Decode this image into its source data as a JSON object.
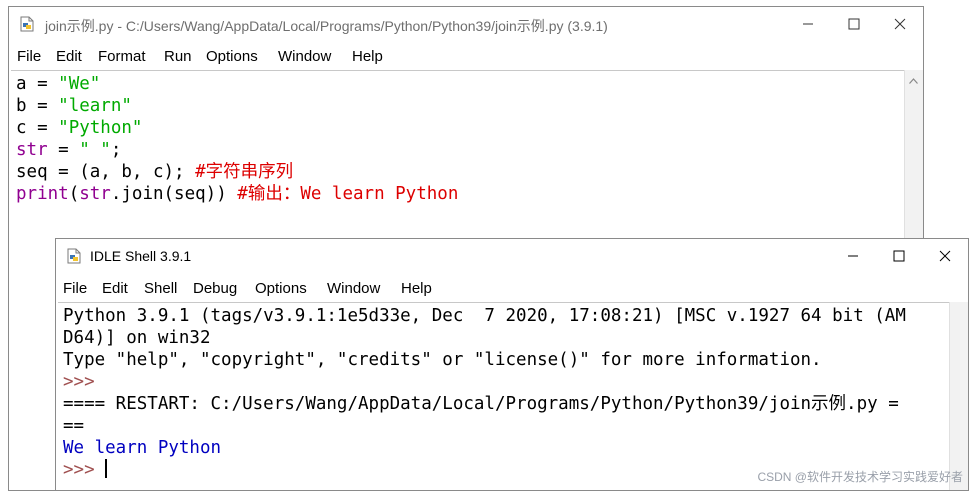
{
  "editor": {
    "title": "join示例.py - C:/Users/Wang/AppData/Local/Programs/Python/Python39/join示例.py (3.9.1)",
    "menu": [
      "File",
      "Edit",
      "Format",
      "Run",
      "Options",
      "Window",
      "Help"
    ],
    "code": [
      [
        {
          "t": "a = ",
          "c": ""
        },
        {
          "t": "\"We\"",
          "c": "str"
        }
      ],
      [
        {
          "t": "b = ",
          "c": ""
        },
        {
          "t": "\"learn\"",
          "c": "str"
        }
      ],
      [
        {
          "t": "c = ",
          "c": ""
        },
        {
          "t": "\"Python\"",
          "c": "str"
        }
      ],
      [
        {
          "t": "str",
          "c": "bi"
        },
        {
          "t": " = ",
          "c": ""
        },
        {
          "t": "\" \"",
          "c": "str"
        },
        {
          "t": ";",
          "c": ""
        }
      ],
      [
        {
          "t": "seq = (a, b, c); ",
          "c": ""
        },
        {
          "t": "#字符串序列",
          "c": "cm"
        }
      ],
      [
        {
          "t": "print",
          "c": "bi"
        },
        {
          "t": "(",
          "c": ""
        },
        {
          "t": "str",
          "c": "bi"
        },
        {
          "t": ".join(seq)) ",
          "c": ""
        },
        {
          "t": "#输出：We learn Python",
          "c": "cm"
        }
      ]
    ]
  },
  "shell": {
    "title": "IDLE Shell 3.9.1",
    "menu": [
      "File",
      "Edit",
      "Shell",
      "Debug",
      "Options",
      "Window",
      "Help"
    ],
    "lines": [
      [
        {
          "t": "Python 3.9.1 (tags/v3.9.1:1e5d33e, Dec  7 2020, 17:08:21) [MSC v.1927 64 bit (AM",
          "c": ""
        }
      ],
      [
        {
          "t": "D64)] on win32",
          "c": ""
        }
      ],
      [
        {
          "t": "Type \"help\", \"copyright\", \"credits\" or \"license()\" for more information.",
          "c": ""
        }
      ],
      [
        {
          "t": ">>> ",
          "c": "prompt"
        }
      ],
      [
        {
          "t": "==== RESTART: C:/Users/Wang/AppData/Local/Programs/Python/Python39/join示例.py =",
          "c": ""
        }
      ],
      [
        {
          "t": "==",
          "c": ""
        }
      ],
      [
        {
          "t": "We learn Python",
          "c": "out"
        }
      ],
      [
        {
          "t": ">>> ",
          "c": "prompt"
        },
        {
          "t": "",
          "c": "cursor"
        }
      ]
    ]
  },
  "watermark": "CSDN @软件开发技术学习实践爱好者",
  "icons": {
    "file": "python-file-icon",
    "shell": "python-shell-icon",
    "minimize": "minimize-icon",
    "maximize": "maximize-icon",
    "close": "close-icon"
  }
}
